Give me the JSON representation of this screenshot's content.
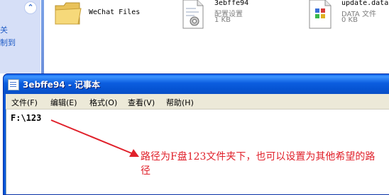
{
  "explorer": {
    "task_pane": {
      "links": [
        "关",
        "制到"
      ]
    },
    "files": [
      {
        "name": "WeChat Files",
        "type": "folder"
      },
      {
        "name": "3ebffe94",
        "type_label": "配置设置",
        "size": "1 KB",
        "icon": "config-file-icon"
      },
      {
        "name": "update.data",
        "type_label": "DATA 文件",
        "size": "0 KB",
        "icon": "data-file-icon"
      }
    ]
  },
  "notepad": {
    "title": "3ebffe94 - 记事本",
    "menus": [
      "文件(F)",
      "编辑(E)",
      "格式(O)",
      "查看(V)",
      "帮助(H)"
    ],
    "content": "F:\\123"
  },
  "annotation": {
    "text": "路径为F盘123文件夹下，也可以设置为其他希望的路径",
    "color": "#e0202a"
  }
}
